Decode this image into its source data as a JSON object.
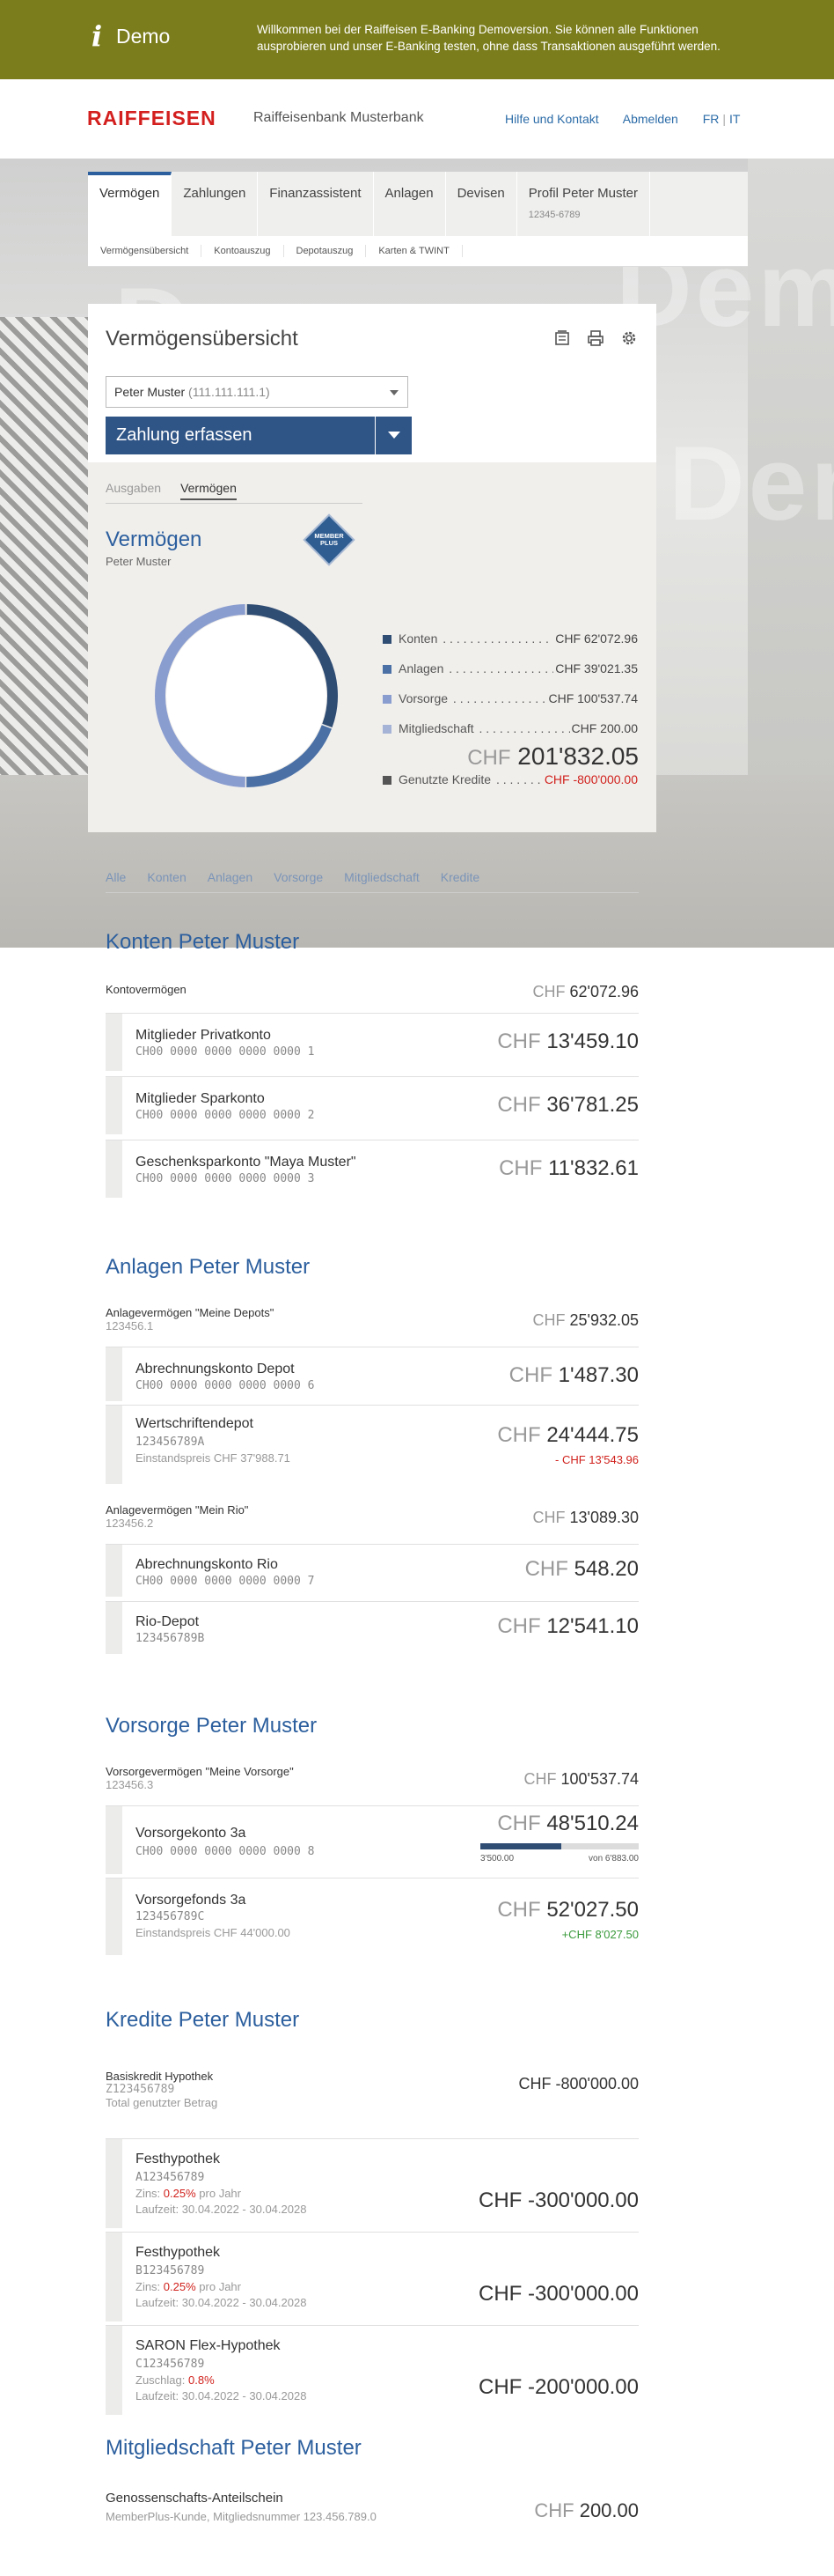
{
  "demo_banner": {
    "icon": "info-icon",
    "label": "Demo",
    "text": "Willkommen bei der Raiffeisen E-Banking Demoversion. Sie können alle Funktionen ausprobieren und unser E-Banking testen, ohne dass Transaktionen ausgeführt werden."
  },
  "header": {
    "logo": "RAIFFEISEN",
    "bank": "Raiffeisenbank Musterbank",
    "help": "Hilfe und Kontakt",
    "logout": "Abmelden",
    "lang_fr": "FR",
    "lang_it": "IT"
  },
  "nav": {
    "tabs": [
      {
        "label": "Vermögen"
      },
      {
        "label": "Zahlungen"
      },
      {
        "label": "Finanzassistent"
      },
      {
        "label": "Anlagen"
      },
      {
        "label": "Devisen"
      },
      {
        "label": "Profil Peter Muster",
        "sub": "12345-6789"
      }
    ],
    "subtabs": [
      "Vermögensübersicht",
      "Kontoauszug",
      "Depotauszug",
      "Karten & TWINT"
    ]
  },
  "overview": {
    "title": "Vermögensübersicht",
    "icons": [
      "doc-stack-icon",
      "print-icon",
      "gear-icon"
    ],
    "select": {
      "name": "Peter Muster",
      "id": "(111.111.111.1)"
    },
    "pay_button": "Zahlung erfassen",
    "tabs": [
      "Ausgaben",
      "Vermögen"
    ],
    "heading": "Vermögen",
    "owner": "Peter Muster",
    "memberplus": "MEMBER PLUS",
    "legend": [
      {
        "label": "Konten",
        "amount": "CHF 62'072.96",
        "value": 62072.96,
        "color": "#2f4c73"
      },
      {
        "label": "Anlagen",
        "amount": "CHF 39'021.35",
        "value": 39021.35,
        "color": "#4a70a6"
      },
      {
        "label": "Vorsorge",
        "amount": "CHF 100'537.74",
        "value": 100537.74,
        "color": "#8a9dcf"
      },
      {
        "label": "Mitgliedschaft",
        "amount": "CHF 200.00",
        "value": 200,
        "color": "#a5b3d6"
      }
    ],
    "total_cur": "CHF",
    "total": "201'832.05",
    "credit": {
      "label": "Genutzte Kredite",
      "amount": "CHF -800'000.00",
      "color": "#555555"
    }
  },
  "filters": [
    "Alle",
    "Konten",
    "Anlagen",
    "Vorsorge",
    "Mitgliedschaft",
    "Kredite"
  ],
  "konten": {
    "title": "Konten Peter Muster",
    "group": {
      "name": "Kontovermögen",
      "cur": "CHF",
      "amount": "62'072.96"
    },
    "rows": [
      {
        "name": "Mitglieder Privatkonto",
        "iban": "CH00 0000 0000 0000 0000 1",
        "cur": "CHF",
        "amount": "13'459.10"
      },
      {
        "name": "Mitglieder Sparkonto",
        "iban": "CH00 0000 0000 0000 0000 2",
        "cur": "CHF",
        "amount": "36'781.25"
      },
      {
        "name": "Geschenksparkonto \"Maya Muster\"",
        "iban": "CH00 0000 0000 0000 0000 3",
        "cur": "CHF",
        "amount": "11'832.61"
      }
    ]
  },
  "anlagen": {
    "title": "Anlagen Peter Muster",
    "group1": {
      "name": "Anlagevermögen \"Meine Depots\"",
      "num": "123456.1",
      "cur": "CHF",
      "amount": "25'932.05"
    },
    "rows1": [
      {
        "name": "Abrechnungskonto Depot",
        "iban": "CH00 0000 0000 0000 0000 6",
        "cur": "CHF",
        "amount": "1'487.30"
      },
      {
        "name": "Wertschriftendepot",
        "iban": "123456789A",
        "sub": "Einstandspreis CHF 37'988.71",
        "cur": "CHF",
        "amount": "24'444.75",
        "note": "- CHF 13'543.96"
      }
    ],
    "group2": {
      "name": "Anlagevermögen \"Mein Rio\"",
      "num": "123456.2",
      "cur": "CHF",
      "amount": "13'089.30"
    },
    "rows2": [
      {
        "name": "Abrechnungskonto Rio",
        "iban": "CH00 0000 0000 0000 0000 7",
        "cur": "CHF",
        "amount": "548.20"
      },
      {
        "name": "Rio-Depot",
        "iban": "123456789B",
        "cur": "CHF",
        "amount": "12'541.10"
      }
    ]
  },
  "vorsorge": {
    "title": "Vorsorge Peter Muster",
    "group": {
      "name": "Vorsorgevermögen \"Meine Vorsorge\"",
      "num": "123456.3",
      "cur": "CHF",
      "amount": "100'537.74"
    },
    "rows": [
      {
        "name": "Vorsorgekonto 3a",
        "iban": "CH00 0000 0000 0000 0000 8",
        "cur": "CHF",
        "amount": "48'510.24",
        "progress": {
          "left": "3'500.00",
          "right": "von 6'883.00",
          "fraction": 0.51
        }
      },
      {
        "name": "Vorsorgefonds 3a",
        "iban": "123456789C",
        "sub": "Einstandspreis CHF 44'000.00",
        "cur": "CHF",
        "amount": "52'027.50",
        "note": "+CHF 8'027.50"
      }
    ]
  },
  "kredite": {
    "title": "Kredite Peter Muster",
    "group": {
      "name": "Basiskredit Hypothek",
      "num": "Z123456789",
      "sub": "Total genutzter Betrag",
      "amount": "CHF -800'000.00"
    },
    "rows": [
      {
        "name": "Festhypothek",
        "iban": "A123456789",
        "rate_label": "Zins:",
        "rate": "0.25%",
        "rate_suffix": "pro Jahr",
        "term": "Laufzeit: 30.04.2022 - 30.04.2028",
        "amount": "CHF -300'000.00"
      },
      {
        "name": "Festhypothek",
        "iban": "B123456789",
        "rate_label": "Zins:",
        "rate": "0.25%",
        "rate_suffix": "pro Jahr",
        "term": "Laufzeit: 30.04.2022 - 30.04.2028",
        "amount": "CHF -300'000.00"
      },
      {
        "name": "SARON Flex-Hypothek",
        "iban": "C123456789",
        "rate_label": "Zuschlag:",
        "rate": "0.8%",
        "rate_suffix": "",
        "term": "Laufzeit: 30.04.2022 - 30.04.2028",
        "amount": "CHF -200'000.00"
      }
    ]
  },
  "mitgliedschaft": {
    "title": "Mitgliedschaft Peter Muster",
    "name": "Genossenschafts-Anteilschein",
    "sub": "MemberPlus-Kunde, Mitgliedsnummer 123.456.789.0",
    "cur": "CHF",
    "amount": "200.00"
  }
}
